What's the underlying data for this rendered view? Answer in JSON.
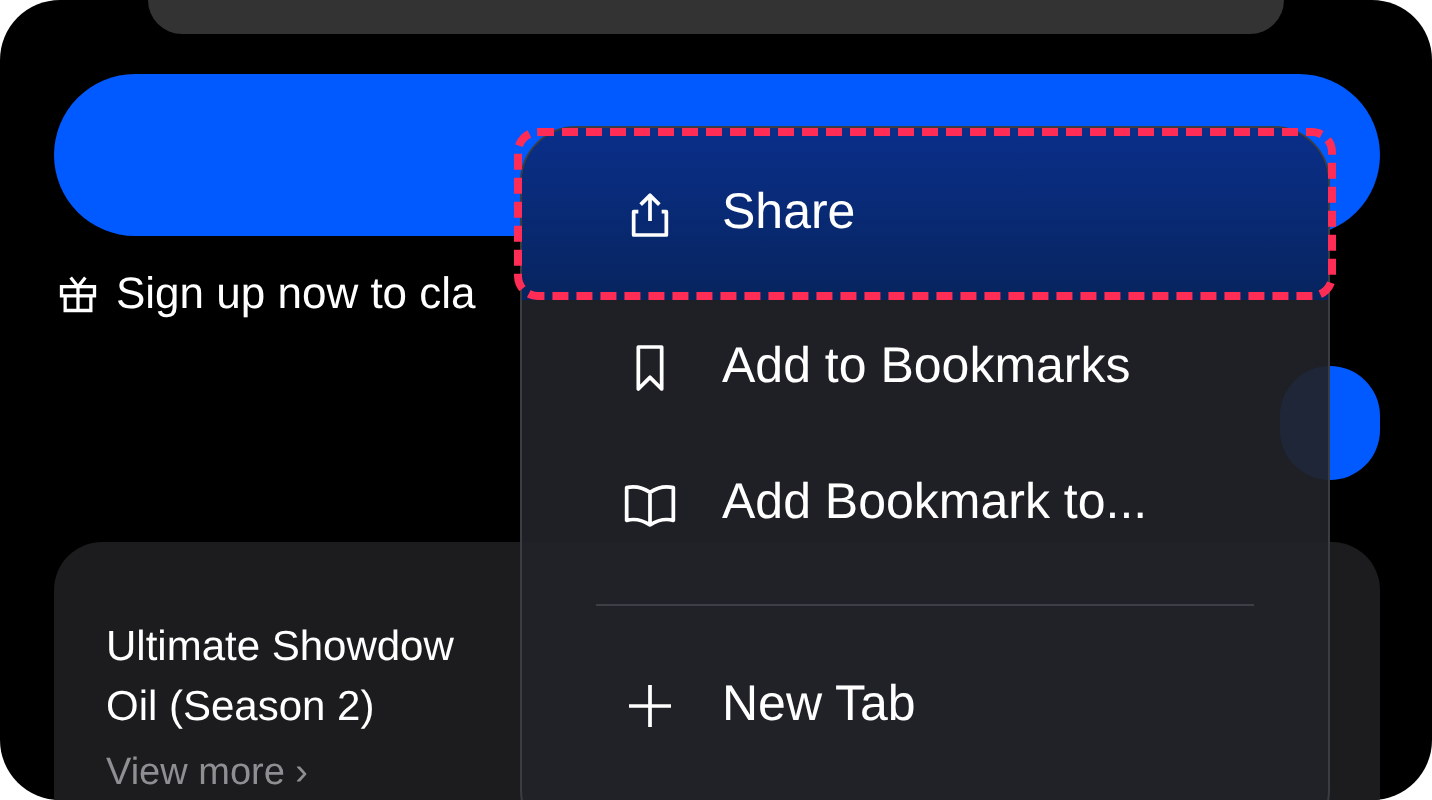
{
  "promo": {
    "text": "Sign up now to cla"
  },
  "card": {
    "title_lines": [
      "Ultimate Showdow",
      "Oil (Season 2)"
    ],
    "link": "View more",
    "link_chevron": "›"
  },
  "menu": {
    "groups": [
      [
        {
          "label": "Share",
          "kind": "share",
          "highlighted": true
        },
        {
          "label": "Add to Bookmarks",
          "kind": "bookmark",
          "highlighted": false
        },
        {
          "label": "Add Bookmark to...",
          "kind": "book",
          "highlighted": false
        }
      ],
      [
        {
          "label": "New Tab",
          "kind": "new",
          "highlighted": false
        }
      ]
    ]
  }
}
